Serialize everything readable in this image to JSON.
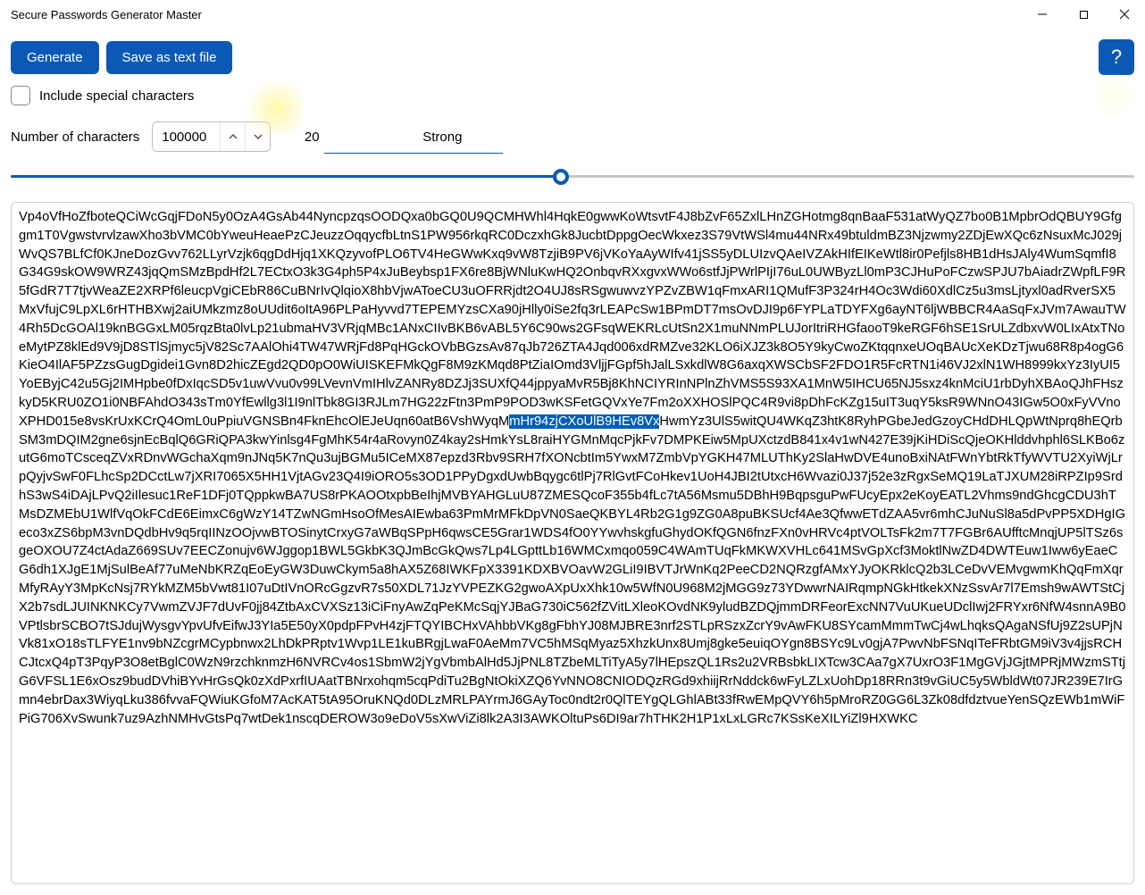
{
  "window": {
    "title": "Secure Passwords Generator Master"
  },
  "toolbar": {
    "generate_label": "Generate",
    "save_label": "Save as text file",
    "help_label": "?"
  },
  "options": {
    "special_label": "Include special characters",
    "special_checked": false,
    "numchars_label": "Number of characters",
    "numchars_value": "100000"
  },
  "slider": {
    "current_value": "20",
    "strength_label": "Strong",
    "fill_percent": 49,
    "thumb_percent": 49
  },
  "output": {
    "pre_selection": "Vp4oVfHoZfboteQCiWcGqjFDoN5y0OzA4GsAb44NyncpzqsOODQxa0bGQ0U9QCMHWhl4HqkE0gwwKoWtsvtF4J8bZvF65ZxlLHnZGHotmg8qnBaaF531atWyQZ7bo0B1MpbrOdQBUY9Gfggm1T0VgwstvrvlzawXho3bVMC0bYweuHeaePzCJeuzzOqqycfbLtnS1PW956rkqRC0DczxhGk8JucbtDppgOecWkxez3S79VtWSl4mu44NRx49btuldmBZ3Njzwmy2ZDjEwXQc6zNsuxMcJ029jWvQS7BLfCf0KJneDozGvv762LLyrVzjk6qgDdHjq1XKQzyvofPLO6TV4HeGWwKxq9vW8TzjiB9PV6jVKoYaAyWIfv41jSS5yDLUIzvQAeIVZAkHIfEIKeWtl8ir0Pefjls8HB1dHsJAly4WumSqmfI8G34G9skOW9WRZ43jqQmSMzBpdHf2L7ECtxO3k3G4ph5P4xJuBeybsp1FX6re8BjWNluKwHQ2OnbqvRXxgvxWWo6stfJjPWrlPIjI76uL0UWByzLl0mP3CJHuPoFCzwSPJU7bAiadrZWpfLF9R5fGdR7T7tjvWeaZE2XRPf6leucpVgiCEbR86CuBNrIvQlqioX8hbVjwAToeCU3uOFRRjdt2O4UJ8sRSgwuwvzYPZvZBW1qFmxARI1QMufF3P324rH4Oc3Wdi60XdlCz5u3msLjtyxl0adRverSX5MxVfujC9LpXL6rHTHBXwj2aiUMkzmz8oUUdit6oItA96PLPaHyvvd7TEPEMYzsCXa90jHlly0iSe2fq3rLEAPcSw1BPmDT7msOvDJI9p6FYPLaTDYFXg6ayNT6ljWBBCR4AaSqFxJVm7AwauTW4Rh5DcGOAl19knBGGxLM05rqzBta0lvLp21ubmaHV3VRjqMBc1ANxCIIvBKB6vABL5Y6C90ws2GFsqWEKRLcUtSn2X1muNNmPLUJorItriRHGfaooT9keRGF6hSE1SrULZdbxvW0LIxAtxTNoeMytPZ8klEd9V9jD8STlSjmyc5jV82Sc7AAlOhi4TW47WRjFd8PqHGckOVbBGzsAv87qJb726ZTA4Jqd006xdRMZve32KLO6iXJZ3k8O5Y9kyCwoZKtqqnxeUOqBAUcXeKDzTjwu68R8p4ogG6KieO4IlAF5PZzsGugDgidei1Gvn8D2hicZEgd2QD0pO0WiUISKEFMkQgF8M9zKMqd8PtZiaIOmd3VljjFGpf5hJalLSxkdlW8G6axqXWSCbSF2FDO1R5FcRTN1i46VJ2xlN1WH8999kxYz3IyUI5YoEByjC42u5Gj2IMHpbe0fDxIqcSD5v1uwVvu0v99LVevnVmIHlvZANRy8DZJj3SUXfQ44jppyaMvR5Bj8KhNCIYRInNPlnZhVMS5S93XA1MnW5IHCU65NJ5sxz4knMciU1rbDyhXBAoQJhFHszkyD5KRU0ZO1i0NBFAhdO343sTm0YfEwllg3l1I9nlTbk8GI3RJLm7HG22zFtn3PmP9POD3wKSFetGQVxYe7Fm2oXXHOSlPQC4R9vi8pDhFcKZg15uIT3uqY5ksR9WNnO43IGw5O0xFyVVnoXPHD015e8vsKrUxKCrQ4OmL0uPpiuVGNSBn4FknEhcOlEJeUqn60atB6VshWyqM",
    "selection": "mHr94zjCXoUlB9HEv8Vx",
    "post_selection": "HwmYz3UlS5witQU4WKqZ3htK8RyhPGbeJedGzoyCHdDHLQpWtNprq8hEQrbSM3mDQIM2gne6sjnEcBqlQ6GRiQPA3kwYinlsg4FgMhK54r4aRovyn0Z4kay2sHmkYsL8raiHYGMnMqcPjkFv7DMPKEiw5MpUXctzdB841x4v1wN427E39jKiHDiScQjeOKHlddvhphl6SLKBo6zutG6moTCsceqZVxRDnvWGchaXqm9nJNq5K7nQu3ujBGMu5ICeMX87epzd3Rbv9SRH7fXONcbtIm5YwxM7ZmbVpYGKH47MLUThKy2SlaHwDVE4unoBxiNAtFWnYbtRkTfyWVTU2XyiWjLrpQyjvSwF0FLhcSp2DCctLw7jXRI7065X5HH1VjtAGv23Q4I9iORO5s3OD1PPyDgxdUwbBqygc6tlPj7RlGvtFCoHkev1UoH4JBI2tUtxcH6Wvazi0J37j52e3zRgxSeMQ19LaTJXUM28iRPZIp9SrdhS3wS4iDAjLPvQ2iIlesuc1ReF1DFj0TQppkwBA7US8rPKAOOtxpbBeIhjMVBYAHGLuU87ZMESQcoF355b4fLc7tA56Msmu5DBhH9BqpsguPwFUcyEpx2eKoyEATL2Vhms9ndGhcgCDU3hTMsDZMEbU1WlfVqOkFCdE6EimxC6gWzY14TZwNGmHsoOfMesAIEwba63PmMrMFkDpVN0SaeQKBYL4Rb2G1g9ZG0A8puBKSUcf4Ae3QfwwETdZAA5vr6mhCJuNuSl8a5dPvPP5XDHgIGeco3xZS6bpM3vnDQdbHv9q5rqIINzOOjvwBTOSinytCrxyG7aWBqSPpH6qwsCE5Grar1WDS4fO0YYwvhskgfuGhydOKfQGN6fnzFXn0vHRVc4ptVOLTsFk2m7T7FGBr6AUfftcMnqjUP5lTSz6sgeOXOU7Z4ctAdaZ669SUv7EECZonujv6WJggop1BWL5GkbK3QJmBcGkQws7Lp4LGpttLb16WMCxmqo059C4WAmTUqFkMKWXVHLc641MSvGpXcf3MoktlNwZD4DWTEuw1Iww6yEaeCG6dh1XJgE1MjSulBeAf77uMeNbKRZqEoEyGW3DuwCkym5a8hAX5Z68IWKFpX3391KDXBVOavW2GLiI9IBVTJrWnKq2PeeCD2NQRzgfAMxYJyOKRklcQ2b3LCeDvVEMvgwmKhQqFmXqrMfyRAyY3MpKcNsj7RYkMZM5bVwt81I07uDtIVnORcGgzvR7s50XDL71JzYVPEZKG2gwoAXpUxXhk10w5WfN0U968M2jMGG9z73YDwwrNAIRqmpNGkHtkekXNzSsvAr7l7Emsh9wAWTStCjX2b7sdLJUINKNKCy7VwmZVJF7dUvF0jj84ZtbAxCVXSz13iCiFnyAwZqPeKMcSqjYJBaG730iC562fZVitLXleoKOvdNK9yludBZDQjmmDRFeorExcNN7VuUKueUDclIwj2FRYxr6NfW4snnA9B0VPtlsbrSCBO7tSJdujWysgvYpvUfvEifwJ3YIa5E50yX0pdpFPvH4zjFTQYIBCHxVAhbbVKg8gFbhYJ08MJBRE3nrf2STLpRSzxZcrY9vAwFKU8SYcamMmmTwCj4wLhqksQAgaNSfUj9Z2sUPjNVk81xO18sTLFYE1nv9bNZcgrMCypbnwx2LhDkPRptv1Wvp1LE1kuBRgjLwaF0AeMm7VC5hMSqMyaz5XhzkUnx8Umj8gke5euiqOYgn8BSYc9Lv0gjA7PwvNbFSNqITeFRbtGM9iV3v4jjsRCHCJtcxQ4pT3PqyP3O8etBglC0WzN9rzchknmzH6NVRCv4os1SbmW2jYgVbmbAlHd5JjPNL8TZbeMLTiTyA5y7lHEpszQL1Rs2u2VRBsbkLIXTcw3CAa7gX7UxrO3F1MgGVjJGjtMPRjMWzmSTtjG6VFSL1E6xOsz9budDVhiBYvHrGsQk0zXdPxrfIUAatTBNrxohqm5cqPdiTu2BgNtOkiXZQ6YvNNO8CNIODQzRGd9xhiijRrNddck6wFyLZLxUohDp18RRn3t9vGiUC5y5WbldWt07JR239E7IrGmn4ebrDax3WiyqLku386fvvaFQWiuKGfoM7AcKAT5tA95OruKNQd0DLzMRLPAYrmJ6GAyToc0ndt2r0QlTEYgQLGhlABt33fRwEMpQVY6h5pMroRZ0GG6L3Zk08dfdztvueYenSQzEWb1mWiFPiG706XvSwunk7uz9AzhNMHvGtsPq7wtDek1nscqDEROW3o9eDoV5sXwViZi8lk2A3I3AWKOltuPs6DI9ar7hTHK2H1P1xLxLGRc7KSsKeXILYiZl9HXWKC"
  }
}
